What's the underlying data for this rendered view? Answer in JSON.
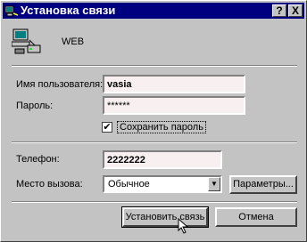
{
  "window": {
    "title": "Установка связи",
    "help_glyph": "?",
    "close_glyph": "X"
  },
  "connection": {
    "name": "WEB"
  },
  "credentials": {
    "username_label": "Имя пользователя:",
    "username_value": "vasia",
    "password_label": "Пароль:",
    "password_value": "******",
    "save_password_label": "Сохранить пароль",
    "save_password_checked": true
  },
  "dialing": {
    "phone_label": "Телефон:",
    "phone_value": "2222222",
    "location_label": "Место вызова:",
    "location_value": "Обычное",
    "properties_button": "Параметры..."
  },
  "actions": {
    "connect_button": "Установить связь",
    "cancel_button": "Отмена"
  }
}
